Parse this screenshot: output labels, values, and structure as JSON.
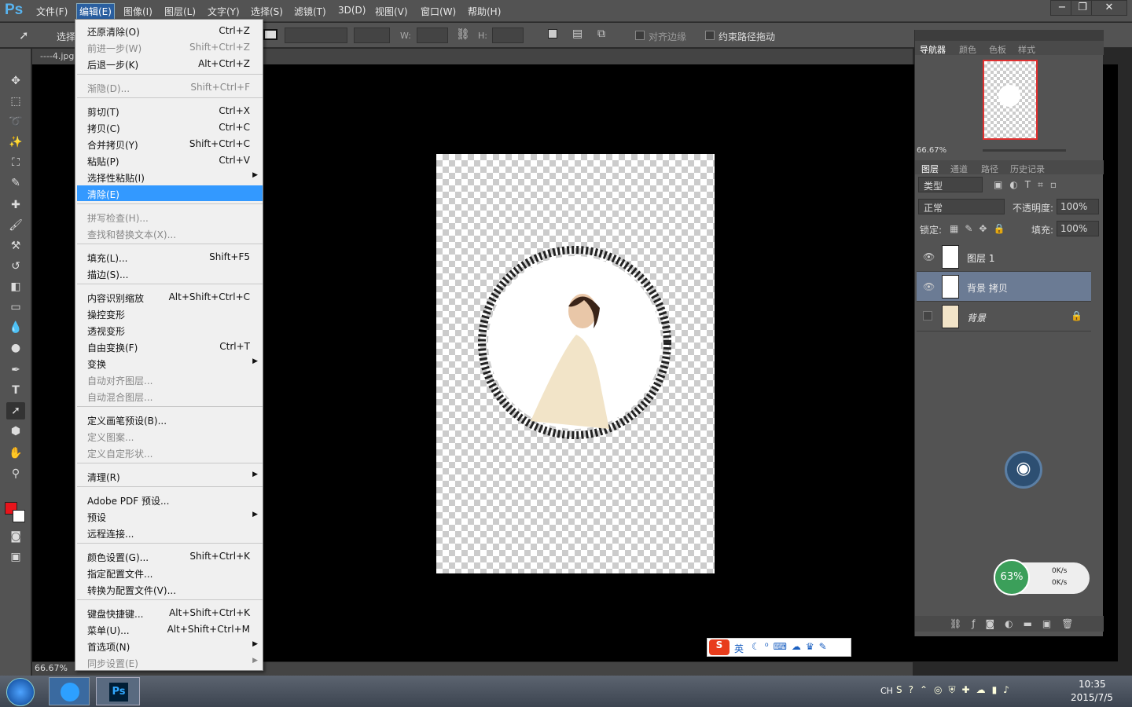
{
  "app": {
    "logo": "Ps"
  },
  "menubar": {
    "items": [
      "文件(F)",
      "编辑(E)",
      "图像(I)",
      "图层(L)",
      "文字(Y)",
      "选择(S)",
      "滤镜(T)",
      "3D(D)",
      "视图(V)",
      "窗口(W)",
      "帮助(H)"
    ],
    "active": "编辑(E)"
  },
  "window_controls": {
    "minimize": "−",
    "restore": "❐",
    "close": "✕"
  },
  "options": {
    "select_label": "选择",
    "w_label": "W:",
    "h_label": "H:",
    "align_edges": "对齐边缘",
    "constrain_path": "约束路径拖动"
  },
  "document": {
    "tab_title": "----4.jpg",
    "zoom": "66.67%"
  },
  "edit_menu": {
    "items": [
      {
        "label": "还原清除(O)",
        "shortcut": "Ctrl+Z",
        "enabled": true
      },
      {
        "label": "前进一步(W)",
        "shortcut": "Shift+Ctrl+Z",
        "enabled": false
      },
      {
        "label": "后退一步(K)",
        "shortcut": "Alt+Ctrl+Z",
        "enabled": true
      },
      {
        "label": "渐隐(D)...",
        "shortcut": "Shift+Ctrl+F",
        "enabled": false
      },
      {
        "label": "剪切(T)",
        "shortcut": "Ctrl+X",
        "enabled": true
      },
      {
        "label": "拷贝(C)",
        "shortcut": "Ctrl+C",
        "enabled": true
      },
      {
        "label": "合并拷贝(Y)",
        "shortcut": "Shift+Ctrl+C",
        "enabled": true
      },
      {
        "label": "粘贴(P)",
        "shortcut": "Ctrl+V",
        "enabled": true
      },
      {
        "label": "选择性粘贴(I)",
        "shortcut": "",
        "enabled": true,
        "submenu": true
      },
      {
        "label": "清除(E)",
        "shortcut": "",
        "enabled": true,
        "highlighted": true
      },
      {
        "label": "拼写检查(H)...",
        "shortcut": "",
        "enabled": false
      },
      {
        "label": "查找和替换文本(X)...",
        "shortcut": "",
        "enabled": false
      },
      {
        "label": "填充(L)...",
        "shortcut": "Shift+F5",
        "enabled": true
      },
      {
        "label": "描边(S)...",
        "shortcut": "",
        "enabled": true
      },
      {
        "label": "内容识别缩放",
        "shortcut": "Alt+Shift+Ctrl+C",
        "enabled": true
      },
      {
        "label": "操控变形",
        "shortcut": "",
        "enabled": true
      },
      {
        "label": "透视变形",
        "shortcut": "",
        "enabled": true
      },
      {
        "label": "自由变换(F)",
        "shortcut": "Ctrl+T",
        "enabled": true
      },
      {
        "label": "变换",
        "shortcut": "",
        "enabled": true,
        "submenu": true
      },
      {
        "label": "自动对齐图层...",
        "shortcut": "",
        "enabled": false
      },
      {
        "label": "自动混合图层...",
        "shortcut": "",
        "enabled": false
      },
      {
        "label": "定义画笔预设(B)...",
        "shortcut": "",
        "enabled": true
      },
      {
        "label": "定义图案...",
        "shortcut": "",
        "enabled": false
      },
      {
        "label": "定义自定形状...",
        "shortcut": "",
        "enabled": false
      },
      {
        "label": "清理(R)",
        "shortcut": "",
        "enabled": true,
        "submenu": true
      },
      {
        "label": "Adobe PDF 预设...",
        "shortcut": "",
        "enabled": true
      },
      {
        "label": "预设",
        "shortcut": "",
        "enabled": true,
        "submenu": true
      },
      {
        "label": "远程连接...",
        "shortcut": "",
        "enabled": true
      },
      {
        "label": "颜色设置(G)...",
        "shortcut": "Shift+Ctrl+K",
        "enabled": true
      },
      {
        "label": "指定配置文件...",
        "shortcut": "",
        "enabled": true
      },
      {
        "label": "转换为配置文件(V)...",
        "shortcut": "",
        "enabled": true
      },
      {
        "label": "键盘快捷键...",
        "shortcut": "Alt+Shift+Ctrl+K",
        "enabled": true
      },
      {
        "label": "菜单(U)...",
        "shortcut": "Alt+Shift+Ctrl+M",
        "enabled": true
      },
      {
        "label": "首选项(N)",
        "shortcut": "",
        "enabled": true,
        "submenu": true
      },
      {
        "label": "同步设置(E)",
        "shortcut": "",
        "enabled": false,
        "submenu": true
      }
    ]
  },
  "navigator": {
    "tabs": [
      "导航器",
      "颜色",
      "色板",
      "样式"
    ],
    "zoom": "66.67%"
  },
  "layers": {
    "tabs": [
      "图层",
      "通道",
      "路径",
      "历史记录"
    ],
    "kind": "类型",
    "blend": "正常",
    "opacity_label": "不透明度:",
    "opacity": "100%",
    "lock_label": "锁定:",
    "fill_label": "填充:",
    "fill": "100%",
    "items": [
      {
        "name": "图层 1",
        "visible": true,
        "selected": false
      },
      {
        "name": "背景 拷贝",
        "visible": true,
        "selected": true
      },
      {
        "name": "背景",
        "visible": false,
        "selected": false,
        "locked": true
      }
    ]
  },
  "net_widget": {
    "percent": "63%",
    "up": "0K/s",
    "down": "0K/s"
  },
  "ime": {
    "lang": "英"
  },
  "taskbar": {
    "lang": "CH",
    "time": "10:35",
    "date": "2015/7/5"
  },
  "colors": {
    "foreground": "#e8141b",
    "background": "#ffffff",
    "accent": "#3399ff"
  }
}
